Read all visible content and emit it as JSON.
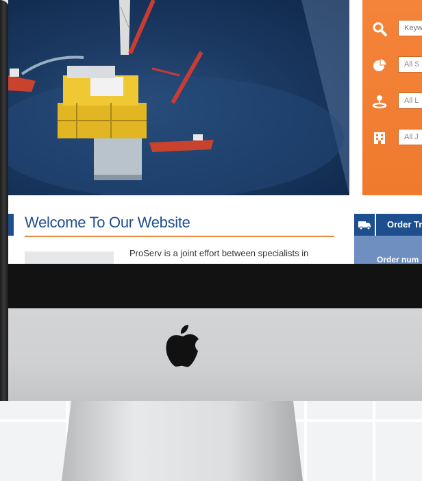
{
  "hero": {
    "scene": "offshore-oil-platform"
  },
  "search_panel": {
    "accent": "#f4843a",
    "fields": [
      {
        "icon": "search-icon",
        "placeholder": "Keyw"
      },
      {
        "icon": "pie-chart-icon",
        "value": "All S"
      },
      {
        "icon": "location-icon",
        "value": "All L"
      },
      {
        "icon": "building-icon",
        "value": "All J"
      }
    ]
  },
  "welcome": {
    "title": "Welcome To Our Website",
    "body": "ProServ is a joint effort between specialists in"
  },
  "order_tracking": {
    "icon": "truck-icon",
    "title": "Order Tr",
    "field_label": "Order num"
  },
  "device": {
    "logo": "apple-logo"
  },
  "colors": {
    "brand_blue": "#1d4f8f",
    "orange": "#f4843a",
    "order_bg": "#6f8fc0",
    "chin_black": "#121212"
  }
}
